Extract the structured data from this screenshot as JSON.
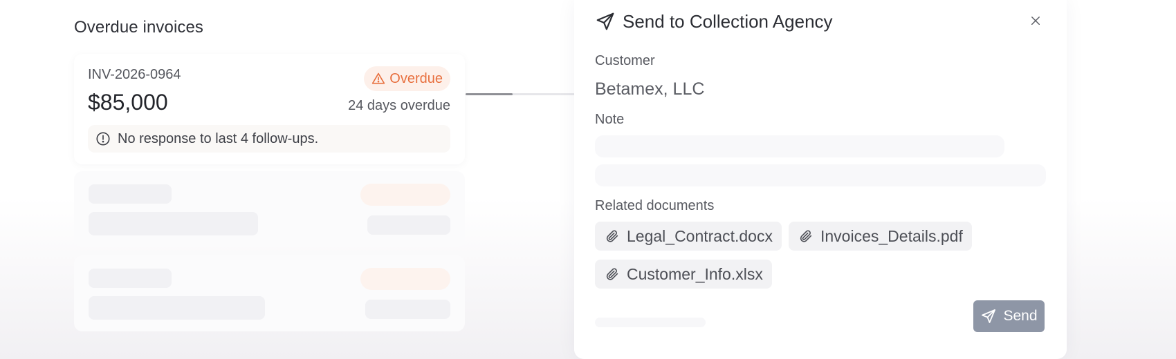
{
  "overdue": {
    "title": "Overdue invoices",
    "invoice": {
      "number": "INV-2026-0964",
      "status": "Overdue",
      "amount": "$85,000",
      "overdue_text": "24 days overdue",
      "note": "No response to last 4 follow-ups."
    },
    "progress": 0.43
  },
  "modal": {
    "title": "Send to Collection Agency",
    "customer_label": "Customer",
    "customer_name": "Betamex, LLC",
    "note_label": "Note",
    "documents_label": "Related documents",
    "documents": [
      "Legal_Contract.docx",
      "Invoices_Details.pdf",
      "Customer_Info.xlsx"
    ],
    "send_label": "Send"
  },
  "colors": {
    "overdue_accent": "#e8703f",
    "overdue_badge_bg": "#fdf0ea",
    "send_button": "#8e96a6"
  },
  "icons": {
    "title": "send-icon",
    "close": "close-icon",
    "status": "warning-icon",
    "note": "info-icon",
    "document": "paperclip-icon",
    "send": "send-icon"
  }
}
